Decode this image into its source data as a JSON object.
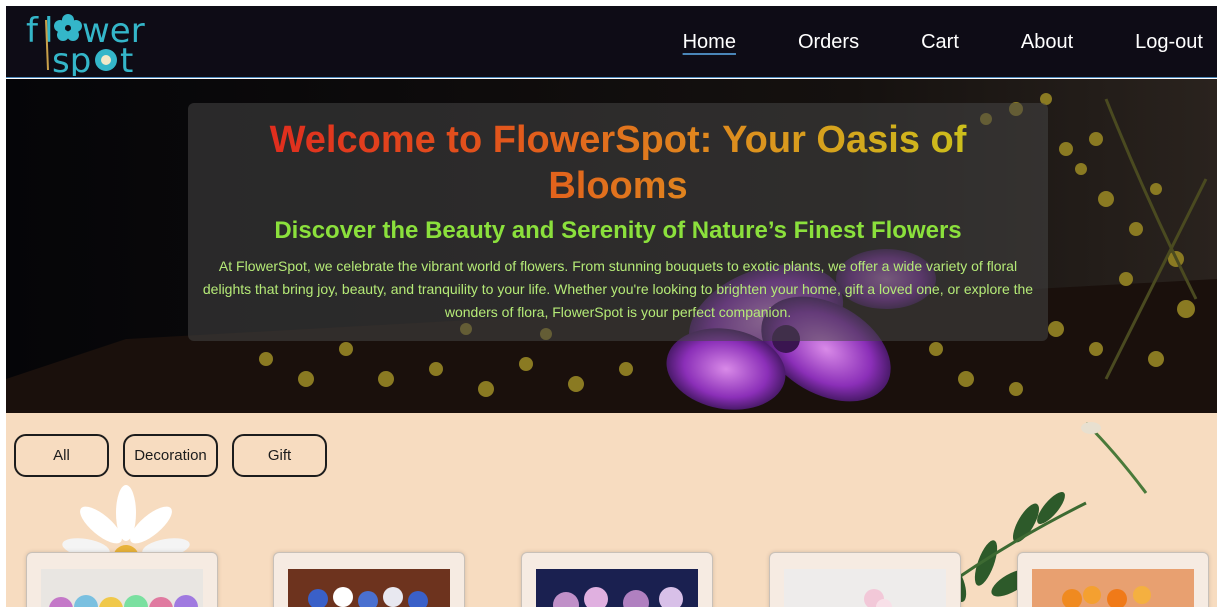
{
  "brand": {
    "logo_line1": "flwer",
    "logo_line2": "spt"
  },
  "nav": {
    "items": [
      {
        "label": "Home",
        "active": true
      },
      {
        "label": "Orders",
        "active": false
      },
      {
        "label": "Cart",
        "active": false
      },
      {
        "label": "About",
        "active": false
      },
      {
        "label": "Log-out",
        "active": false
      }
    ]
  },
  "hero": {
    "title": "Welcome to FlowerSpot: Your Oasis of Blooms",
    "subtitle": "Discover the Beauty and Serenity of Nature’s Finest Flowers",
    "description": "At FlowerSpot, we celebrate the vibrant world of flowers. From stunning bouquets to exotic plants, we offer a wide variety of floral delights that bring joy, beauty, and tranquility to your life. Whether you're looking to brighten your home, gift a loved one, or explore the wonders of flora, FlowerSpot is your perfect companion."
  },
  "filters": [
    {
      "label": "All"
    },
    {
      "label": "Decoration"
    },
    {
      "label": "Gift"
    }
  ],
  "colors": {
    "nav_bg": "#0e0c16",
    "accent_blue": "#4a86b8",
    "subtitle_green": "#8be03c",
    "content_bg": "#f7dcc0"
  }
}
